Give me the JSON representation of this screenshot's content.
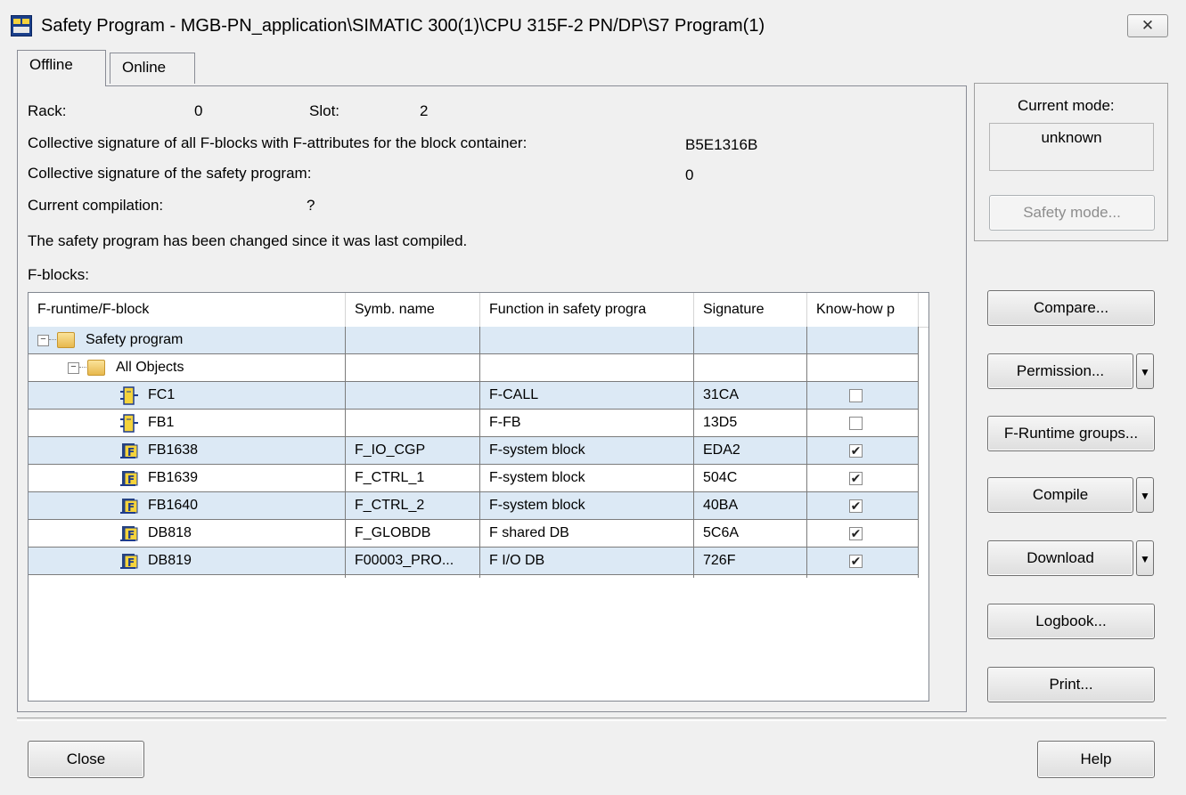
{
  "window": {
    "title": "Safety Program - MGB-PN_application\\SIMATIC 300(1)\\CPU 315F-2 PN/DP\\S7 Program(1)",
    "close_glyph": "✕"
  },
  "tabs": [
    {
      "label": "Offline"
    },
    {
      "label": "Online"
    }
  ],
  "info": {
    "rack_label": "Rack:",
    "rack_value": "0",
    "slot_label": "Slot:",
    "slot_value": "2",
    "collective_fblocks_label": "Collective signature of all F-blocks with F-attributes for the block container:",
    "collective_fblocks_value": "B5E1316B",
    "collective_program_label": "Collective signature of the safety program:",
    "collective_program_value": "0",
    "current_compilation_label": "Current compilation:",
    "current_compilation_value": "?",
    "changed_message": "The safety program has been changed since it was last compiled.",
    "fblocks_label": "F-blocks:"
  },
  "table": {
    "columns": [
      "F-runtime/F-block",
      "Symb. name",
      "Function in safety progra",
      "Signature",
      "Know-how p"
    ],
    "rows": [
      {
        "name": "Safety program",
        "symb": "",
        "function": "",
        "signature": "",
        "knowhow": null,
        "icon": "folder",
        "sign": "−",
        "level": 0
      },
      {
        "name": "All Objects",
        "symb": "",
        "function": "",
        "signature": "",
        "knowhow": null,
        "icon": "folder",
        "sign": "−",
        "level": 1
      },
      {
        "name": "FC1",
        "symb": "",
        "function": "F-CALL",
        "signature": "31CA",
        "knowhow": false,
        "icon": "fc-block",
        "level": 2
      },
      {
        "name": "FB1",
        "symb": "",
        "function": "F-FB",
        "signature": "13D5",
        "knowhow": false,
        "icon": "fc-block",
        "level": 2
      },
      {
        "name": "FB1638",
        "symb": "F_IO_CGP",
        "function": "F-system block",
        "signature": "EDA2",
        "knowhow": true,
        "icon": "f-system-block",
        "level": 2
      },
      {
        "name": "FB1639",
        "symb": "F_CTRL_1",
        "function": "F-system block",
        "signature": "504C",
        "knowhow": true,
        "icon": "f-system-block",
        "level": 2
      },
      {
        "name": "FB1640",
        "symb": "F_CTRL_2",
        "function": "F-system block",
        "signature": "40BA",
        "knowhow": true,
        "icon": "f-system-block",
        "level": 2
      },
      {
        "name": "DB818",
        "symb": "F_GLOBDB",
        "function": "F shared DB",
        "signature": "5C6A",
        "knowhow": true,
        "icon": "f-system-block",
        "level": 2
      },
      {
        "name": "DB819",
        "symb": "F00003_PRO...",
        "function": "F I/O DB",
        "signature": "726F",
        "knowhow": true,
        "icon": "f-system-block",
        "level": 2
      }
    ]
  },
  "mode": {
    "label": "Current mode:",
    "value": "unknown",
    "safety_mode_button": "Safety mode..."
  },
  "buttons": {
    "compare": "Compare...",
    "permission": "Permission...",
    "f_runtime_groups": "F-Runtime groups...",
    "compile": "Compile",
    "download": "Download",
    "logbook": "Logbook...",
    "print": "Print...",
    "close": "Close",
    "help": "Help",
    "dropdown_glyph": "▼"
  },
  "colors": {
    "row_highlight": "#dce9f5",
    "checkmark": "✔"
  }
}
